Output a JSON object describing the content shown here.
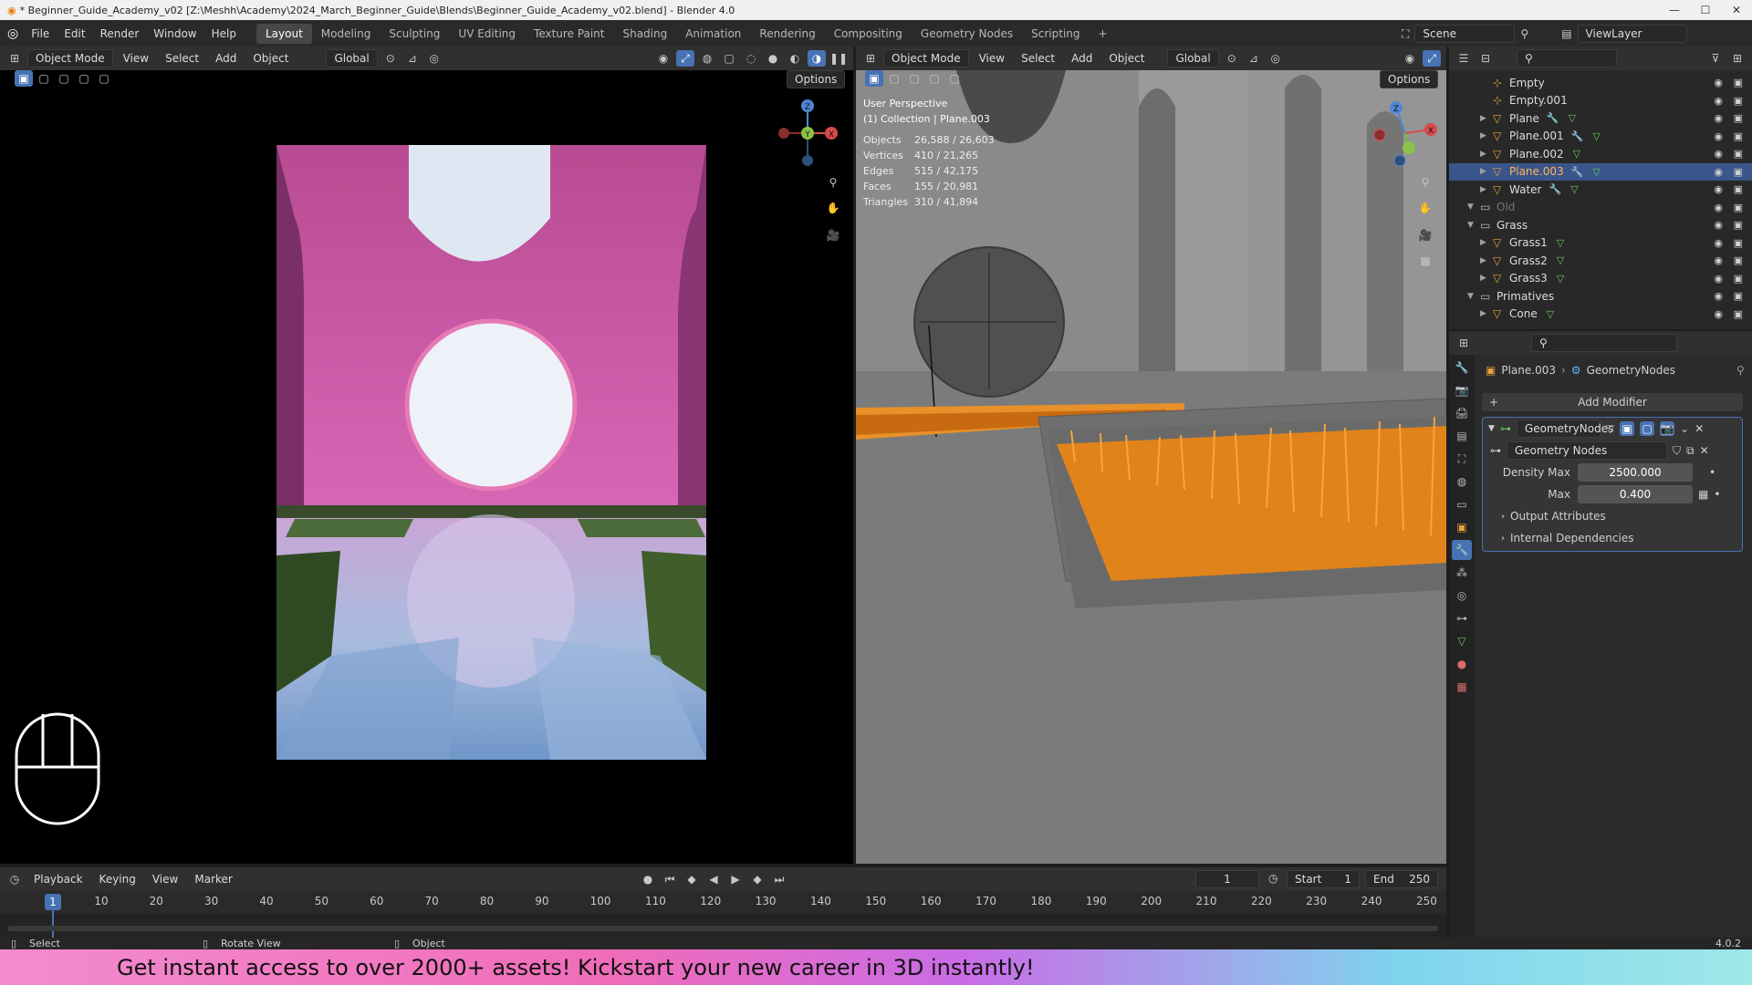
{
  "window": {
    "title": "* Beginner_Guide_Academy_v02 [Z:\\Meshh\\Academy\\2024_March_Beginner_Guide\\Blends\\Beginner_Guide_Academy_v02.blend] - Blender 4.0",
    "controls": [
      "—",
      "☐",
      "✕"
    ]
  },
  "menu": [
    "File",
    "Edit",
    "Render",
    "Window",
    "Help"
  ],
  "workspaces": [
    {
      "label": "Layout",
      "active": true
    },
    {
      "label": "Modeling"
    },
    {
      "label": "Sculpting"
    },
    {
      "label": "UV Editing"
    },
    {
      "label": "Texture Paint"
    },
    {
      "label": "Shading"
    },
    {
      "label": "Animation"
    },
    {
      "label": "Rendering"
    },
    {
      "label": "Compositing"
    },
    {
      "label": "Geometry Nodes"
    },
    {
      "label": "Scripting"
    }
  ],
  "scene": {
    "scene_name": "Scene",
    "view_layer": "ViewLayer"
  },
  "viewport_left": {
    "mode": "Object Mode",
    "menus": [
      "View",
      "Select",
      "Add",
      "Object"
    ],
    "orientation": "Global",
    "options": "Options"
  },
  "viewport_right": {
    "mode": "Object Mode",
    "menus": [
      "View",
      "Select",
      "Add",
      "Object"
    ],
    "orientation": "Global",
    "options": "Options",
    "perspective": "User Perspective",
    "collection": "(1) Collection | Plane.003",
    "stats": [
      {
        "k": "Objects",
        "v": "26,588 / 26,603"
      },
      {
        "k": "Vertices",
        "v": "410 / 21,265"
      },
      {
        "k": "Edges",
        "v": "515 / 42,175"
      },
      {
        "k": "Faces",
        "v": "155 / 20,981"
      },
      {
        "k": "Triangles",
        "v": "310 / 41,894"
      }
    ]
  },
  "outliner": {
    "rows": [
      {
        "label": "Empty",
        "indent": 2,
        "type": "empty"
      },
      {
        "label": "Empty.001",
        "indent": 2,
        "type": "empty"
      },
      {
        "label": "Plane",
        "indent": 2,
        "type": "mesh",
        "mod": true
      },
      {
        "label": "Plane.001",
        "indent": 2,
        "type": "mesh",
        "mod": true
      },
      {
        "label": "Plane.002",
        "indent": 2,
        "type": "mesh"
      },
      {
        "label": "Plane.003",
        "indent": 2,
        "type": "mesh",
        "mod": true,
        "selected": true
      },
      {
        "label": "Water",
        "indent": 2,
        "type": "mesh",
        "mod": true
      },
      {
        "label": "Old",
        "indent": 1,
        "type": "collection",
        "dim": true
      },
      {
        "label": "Grass",
        "indent": 1,
        "type": "collection"
      },
      {
        "label": "Grass1",
        "indent": 2,
        "type": "mesh"
      },
      {
        "label": "Grass2",
        "indent": 2,
        "type": "mesh"
      },
      {
        "label": "Grass3",
        "indent": 2,
        "type": "mesh"
      },
      {
        "label": "Primatives",
        "indent": 1,
        "type": "collection"
      },
      {
        "label": "Cone",
        "indent": 2,
        "type": "mesh"
      }
    ]
  },
  "properties": {
    "object": "Plane.003",
    "modifier_ctx": "GeometryNodes",
    "add_modifier": "Add Modifier",
    "modifier_name": "GeometryNodes",
    "node_group": "Geometry Nodes",
    "fields": [
      {
        "label": "Density Max",
        "value": "2500.000"
      },
      {
        "label": "Max",
        "value": "0.400"
      }
    ],
    "panels": [
      "Output Attributes",
      "Internal Dependencies"
    ]
  },
  "timeline": {
    "menus": [
      "Playback",
      "Keying",
      "View",
      "Marker"
    ],
    "current_frame": "1",
    "start_label": "Start",
    "start": "1",
    "end_label": "End",
    "end": "250",
    "ticks": [
      "1",
      "10",
      "20",
      "30",
      "40",
      "50",
      "60",
      "70",
      "80",
      "90",
      "100",
      "110",
      "120",
      "130",
      "140",
      "150",
      "160",
      "170",
      "180",
      "190",
      "200",
      "210",
      "220",
      "230",
      "240",
      "250"
    ]
  },
  "status": {
    "select": "Select",
    "rotate": "Rotate View",
    "object": "Object",
    "version": "4.0.2"
  },
  "banner": "Get instant access to over 2000+ assets! Kickstart your new career in 3D instantly!"
}
